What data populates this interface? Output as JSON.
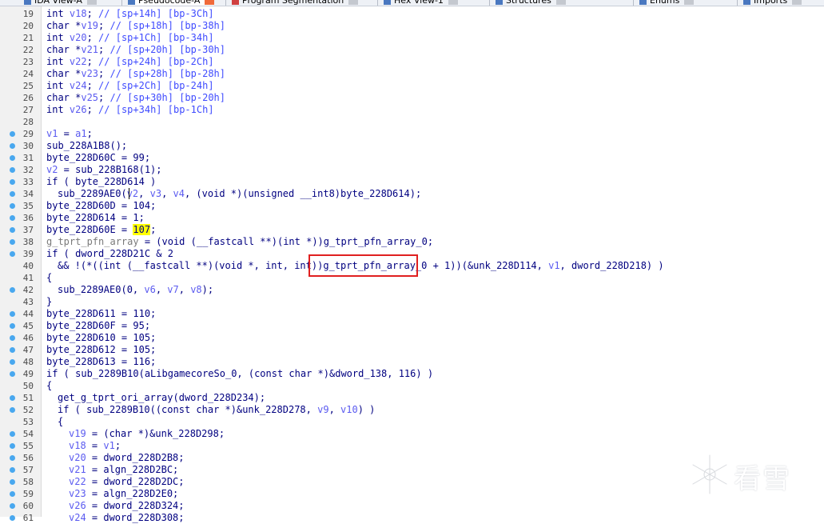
{
  "tabs": [
    {
      "label": "IDA View-A",
      "active": false
    },
    {
      "label": "Pseudocode-A",
      "active": true
    },
    {
      "label": "Program Segmentation",
      "active": false
    },
    {
      "label": "Hex View-1",
      "active": false
    },
    {
      "label": "Structures",
      "active": false
    },
    {
      "label": "Enums",
      "active": false
    },
    {
      "label": "Imports",
      "active": false
    }
  ],
  "lines": [
    {
      "n": "19",
      "bp": false,
      "indent": 0,
      "segs": [
        [
          "kw",
          "int "
        ],
        [
          "var",
          "v18"
        ],
        [
          "kw",
          "; "
        ],
        [
          "cm",
          "// [sp+14h] [bp-3Ch]"
        ]
      ]
    },
    {
      "n": "20",
      "bp": false,
      "indent": 0,
      "segs": [
        [
          "kw",
          "char *"
        ],
        [
          "var",
          "v19"
        ],
        [
          "kw",
          "; "
        ],
        [
          "cm",
          "// [sp+18h] [bp-38h]"
        ]
      ]
    },
    {
      "n": "21",
      "bp": false,
      "indent": 0,
      "segs": [
        [
          "kw",
          "int "
        ],
        [
          "var",
          "v20"
        ],
        [
          "kw",
          "; "
        ],
        [
          "cm",
          "// [sp+1Ch] [bp-34h]"
        ]
      ]
    },
    {
      "n": "22",
      "bp": false,
      "indent": 0,
      "segs": [
        [
          "kw",
          "char *"
        ],
        [
          "var",
          "v21"
        ],
        [
          "kw",
          "; "
        ],
        [
          "cm",
          "// [sp+20h] [bp-30h]"
        ]
      ]
    },
    {
      "n": "23",
      "bp": false,
      "indent": 0,
      "segs": [
        [
          "kw",
          "int "
        ],
        [
          "var",
          "v22"
        ],
        [
          "kw",
          "; "
        ],
        [
          "cm",
          "// [sp+24h] [bp-2Ch]"
        ]
      ]
    },
    {
      "n": "24",
      "bp": false,
      "indent": 0,
      "segs": [
        [
          "kw",
          "char *"
        ],
        [
          "var",
          "v23"
        ],
        [
          "kw",
          "; "
        ],
        [
          "cm",
          "// [sp+28h] [bp-28h]"
        ]
      ]
    },
    {
      "n": "25",
      "bp": false,
      "indent": 0,
      "segs": [
        [
          "kw",
          "int "
        ],
        [
          "var",
          "v24"
        ],
        [
          "kw",
          "; "
        ],
        [
          "cm",
          "// [sp+2Ch] [bp-24h]"
        ]
      ]
    },
    {
      "n": "26",
      "bp": false,
      "indent": 0,
      "segs": [
        [
          "kw",
          "char *"
        ],
        [
          "var",
          "v25"
        ],
        [
          "kw",
          "; "
        ],
        [
          "cm",
          "// [sp+30h] [bp-20h]"
        ]
      ]
    },
    {
      "n": "27",
      "bp": false,
      "indent": 0,
      "segs": [
        [
          "kw",
          "int "
        ],
        [
          "var",
          "v26"
        ],
        [
          "kw",
          "; "
        ],
        [
          "cm",
          "// [sp+34h] [bp-1Ch]"
        ]
      ]
    },
    {
      "n": "28",
      "bp": false,
      "indent": 0,
      "segs": []
    },
    {
      "n": "29",
      "bp": true,
      "indent": 0,
      "segs": [
        [
          "var",
          "v1"
        ],
        [
          "kw",
          " = "
        ],
        [
          "var",
          "a1"
        ],
        [
          "kw",
          ";"
        ]
      ]
    },
    {
      "n": "30",
      "bp": true,
      "indent": 0,
      "segs": [
        [
          "kw",
          "sub_228A1B8();"
        ]
      ]
    },
    {
      "n": "31",
      "bp": true,
      "indent": 0,
      "segs": [
        [
          "kw",
          "byte_228D60C = 99;"
        ]
      ]
    },
    {
      "n": "32",
      "bp": true,
      "indent": 0,
      "segs": [
        [
          "var",
          "v2"
        ],
        [
          "kw",
          " = sub_228B168(1);"
        ]
      ]
    },
    {
      "n": "33",
      "bp": true,
      "indent": 0,
      "segs": [
        [
          "kw",
          "if ( byte_228D614 )"
        ]
      ]
    },
    {
      "n": "34",
      "bp": true,
      "indent": 1,
      "segs": [
        [
          "kw",
          "sub_2289AE0("
        ],
        [
          "var",
          "v2"
        ],
        [
          "kw",
          ", "
        ],
        [
          "var",
          "v3"
        ],
        [
          "kw",
          ", "
        ],
        [
          "var",
          "v4"
        ],
        [
          "kw",
          ", (void *)(unsigned __int8)byte_228D614);"
        ]
      ]
    },
    {
      "n": "35",
      "bp": true,
      "indent": 0,
      "segs": [
        [
          "kw",
          "byte_228D60D = 104;"
        ]
      ]
    },
    {
      "n": "36",
      "bp": true,
      "indent": 0,
      "segs": [
        [
          "kw",
          "byte_228D614 = 1;"
        ]
      ]
    },
    {
      "n": "37",
      "bp": true,
      "indent": 0,
      "segs": [
        [
          "kw",
          "byte_228D60E = "
        ],
        [
          "hl",
          "107"
        ],
        [
          "kw",
          ";"
        ]
      ]
    },
    {
      "n": "38",
      "bp": true,
      "indent": 0,
      "segs": [
        [
          "gray",
          "g_tprt_pfn_array"
        ],
        [
          "kw",
          " = (void (__fastcall **)(int *))g_tprt_pfn_array_0;"
        ]
      ]
    },
    {
      "n": "39",
      "bp": true,
      "indent": 0,
      "segs": [
        [
          "kw",
          "if ( dword_228D21C & 2"
        ]
      ]
    },
    {
      "n": "40",
      "bp": false,
      "indent": 1,
      "segs": [
        [
          "kw",
          "&& !(*((int (__fastcall **)(void *, int, int))g_tprt_pfn_array_0 + 1))(&unk_228D114, "
        ],
        [
          "var",
          "v1"
        ],
        [
          "kw",
          ", dword_228D218) )"
        ]
      ]
    },
    {
      "n": "41",
      "bp": false,
      "indent": 0,
      "segs": [
        [
          "kw",
          "{"
        ]
      ]
    },
    {
      "n": "42",
      "bp": true,
      "indent": 1,
      "segs": [
        [
          "kw",
          "sub_2289AE0(0, "
        ],
        [
          "var",
          "v6"
        ],
        [
          "kw",
          ", "
        ],
        [
          "var",
          "v7"
        ],
        [
          "kw",
          ", "
        ],
        [
          "var",
          "v8"
        ],
        [
          "kw",
          ");"
        ]
      ]
    },
    {
      "n": "43",
      "bp": false,
      "indent": 0,
      "segs": [
        [
          "kw",
          "}"
        ]
      ]
    },
    {
      "n": "44",
      "bp": true,
      "indent": 0,
      "segs": [
        [
          "kw",
          "byte_228D611 = 110;"
        ]
      ]
    },
    {
      "n": "45",
      "bp": true,
      "indent": 0,
      "segs": [
        [
          "kw",
          "byte_228D60F = 95;"
        ]
      ]
    },
    {
      "n": "46",
      "bp": true,
      "indent": 0,
      "segs": [
        [
          "kw",
          "byte_228D610 = 105;"
        ]
      ]
    },
    {
      "n": "47",
      "bp": true,
      "indent": 0,
      "segs": [
        [
          "kw",
          "byte_228D612 = 105;"
        ]
      ]
    },
    {
      "n": "48",
      "bp": true,
      "indent": 0,
      "segs": [
        [
          "kw",
          "byte_228D613 = 116;"
        ]
      ]
    },
    {
      "n": "49",
      "bp": true,
      "indent": 0,
      "segs": [
        [
          "kw",
          "if ( sub_2289B10(aLibgamecoreSo_0, (const char *)&dword_138, 116) )"
        ]
      ]
    },
    {
      "n": "50",
      "bp": false,
      "indent": 0,
      "segs": [
        [
          "kw",
          "{"
        ]
      ]
    },
    {
      "n": "51",
      "bp": true,
      "indent": 1,
      "segs": [
        [
          "kw",
          "get_g_tprt_ori_array(dword_228D234);"
        ]
      ]
    },
    {
      "n": "52",
      "bp": true,
      "indent": 1,
      "segs": [
        [
          "kw",
          "if ( sub_2289B10((const char *)&unk_228D278, "
        ],
        [
          "var",
          "v9"
        ],
        [
          "kw",
          ", "
        ],
        [
          "var",
          "v10"
        ],
        [
          "kw",
          ") )"
        ]
      ]
    },
    {
      "n": "53",
      "bp": false,
      "indent": 1,
      "segs": [
        [
          "kw",
          "{"
        ]
      ]
    },
    {
      "n": "54",
      "bp": true,
      "indent": 2,
      "segs": [
        [
          "var",
          "v19"
        ],
        [
          "kw",
          " = (char *)&unk_228D298;"
        ]
      ]
    },
    {
      "n": "55",
      "bp": true,
      "indent": 2,
      "segs": [
        [
          "var",
          "v18"
        ],
        [
          "kw",
          " = "
        ],
        [
          "var",
          "v1"
        ],
        [
          "kw",
          ";"
        ]
      ]
    },
    {
      "n": "56",
      "bp": true,
      "indent": 2,
      "segs": [
        [
          "var",
          "v20"
        ],
        [
          "kw",
          " = dword_228D2B8;"
        ]
      ]
    },
    {
      "n": "57",
      "bp": true,
      "indent": 2,
      "segs": [
        [
          "var",
          "v21"
        ],
        [
          "kw",
          " = algn_228D2BC;"
        ]
      ]
    },
    {
      "n": "58",
      "bp": true,
      "indent": 2,
      "segs": [
        [
          "var",
          "v22"
        ],
        [
          "kw",
          " = dword_228D2DC;"
        ]
      ]
    },
    {
      "n": "59",
      "bp": true,
      "indent": 2,
      "segs": [
        [
          "var",
          "v23"
        ],
        [
          "kw",
          " = algn_228D2E0;"
        ]
      ]
    },
    {
      "n": "60",
      "bp": true,
      "indent": 2,
      "segs": [
        [
          "var",
          "v26"
        ],
        [
          "kw",
          " = dword_228D324;"
        ]
      ]
    },
    {
      "n": "61",
      "bp": true,
      "indent": 2,
      "segs": [
        [
          "var",
          "v24"
        ],
        [
          "kw",
          " = dword_228D308;"
        ]
      ]
    }
  ],
  "watermark": {
    "text": "看雪"
  },
  "colors": {
    "breakpoint": "#49a8ef",
    "highlight": "#ffff00",
    "annotation_box": "#e02020"
  }
}
